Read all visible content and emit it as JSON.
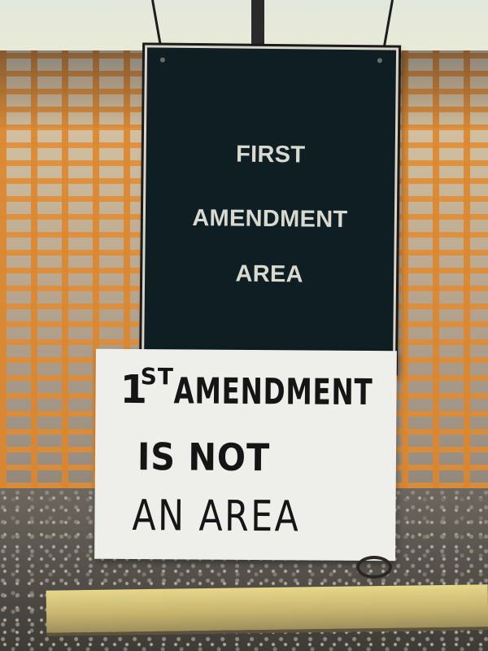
{
  "sign": {
    "lines": [
      "FIRST",
      "AMENDMENT",
      "AREA"
    ]
  },
  "poster": {
    "ordinal": "1",
    "superscript": "ST",
    "line1": "AMENDMENT",
    "line2": "IS NOT",
    "line3": "AN AREA"
  }
}
